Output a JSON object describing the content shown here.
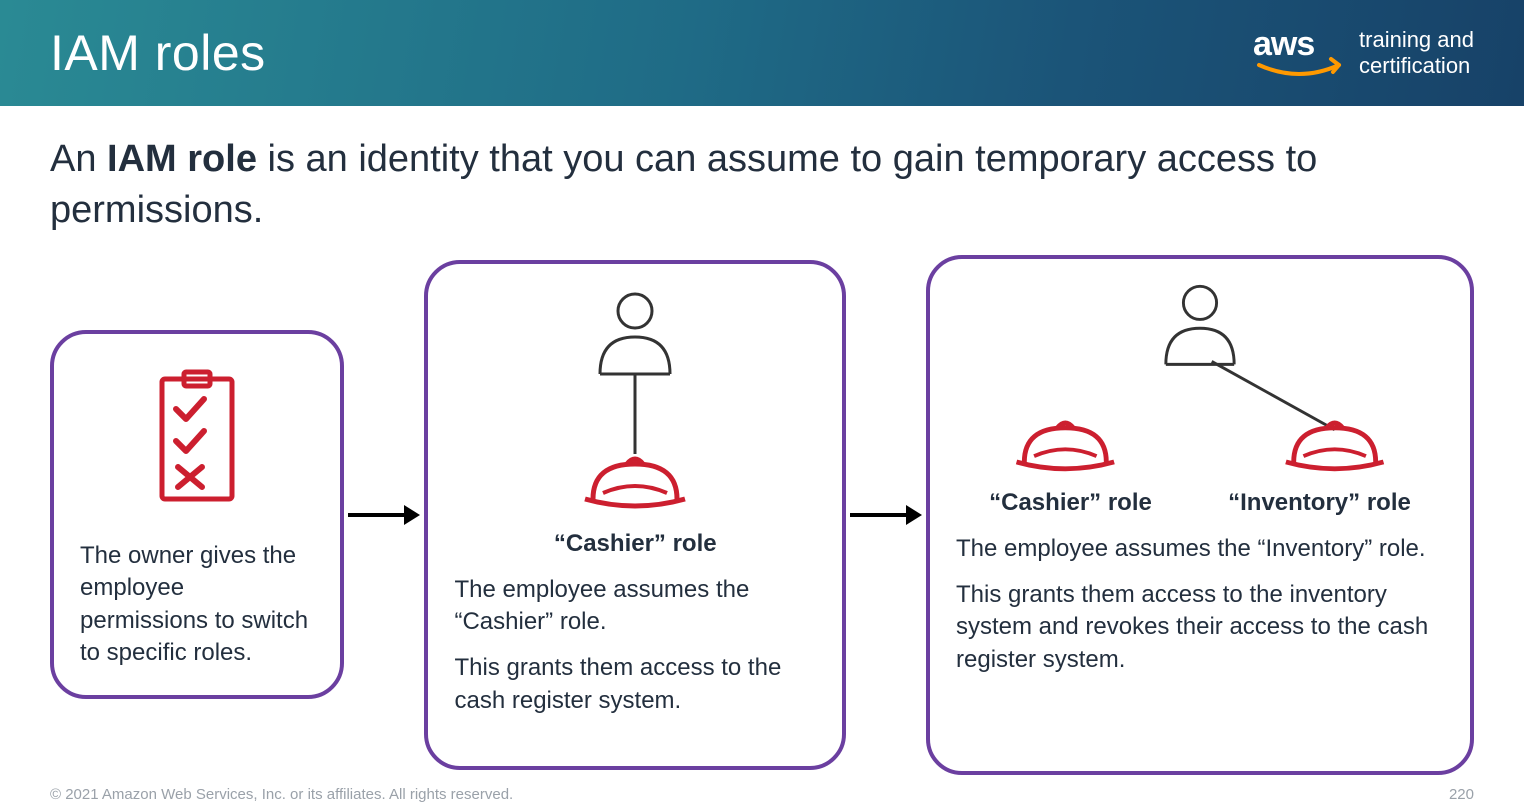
{
  "header": {
    "title": "IAM roles",
    "logo_text": "aws",
    "tagline_line1": "training and",
    "tagline_line2": "certification"
  },
  "lead": {
    "prefix": "An ",
    "bold": "IAM role",
    "suffix": " is an identity that you can assume to gain temporary access to permissions."
  },
  "box1": {
    "text": "The owner gives the employee permissions to switch to specific roles."
  },
  "box2": {
    "role_label": "“Cashier” role",
    "p1": "The employee assumes the “Cashier” role.",
    "p2": "This grants them access to the cash register system."
  },
  "box3": {
    "role_label_left": "“Cashier” role",
    "role_label_right": "“Inventory” role",
    "p1": "The employee assumes the “Inventory” role.",
    "p2": "This grants them access to the inventory system and revokes their access to the cash register system."
  },
  "footer": {
    "copyright": "© 2021 Amazon Web Services, Inc. or its affiliates. All rights reserved.",
    "page": "220"
  },
  "colors": {
    "accent_purple": "#6b3fa0",
    "icon_red": "#cc1f2f",
    "aws_orange": "#ff9900"
  }
}
